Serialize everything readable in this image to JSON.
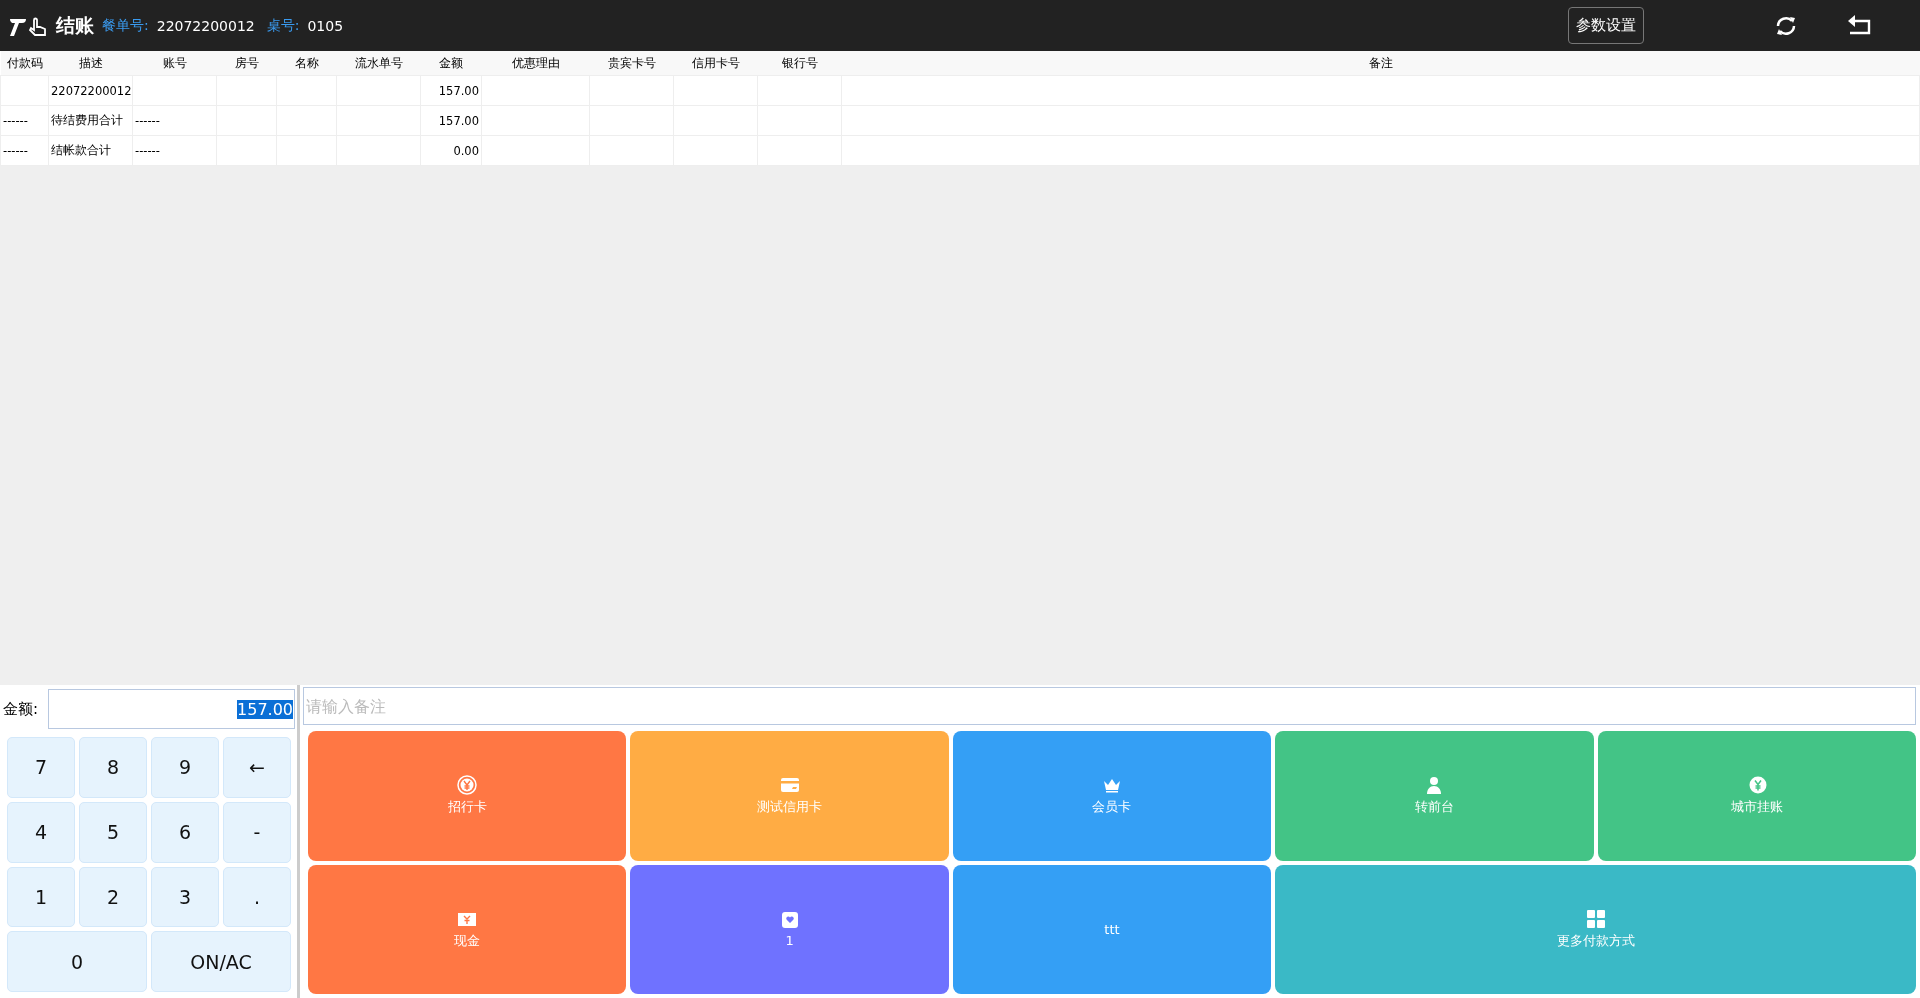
{
  "header": {
    "title": "结账",
    "order_label": "餐单号:",
    "order_no": "22072200012",
    "table_label": "桌号:",
    "table_no": "0105",
    "settings_button": "参数设置"
  },
  "table": {
    "columns": [
      "付款码",
      "描述",
      "账号",
      "房号",
      "名称",
      "流水单号",
      "金额",
      "优惠理由",
      "贵宾卡号",
      "信用卡号",
      "银行号",
      "备注"
    ],
    "rows": [
      {
        "description": "22072200012",
        "amount": "157.00"
      },
      {
        "payment_code": "------",
        "description": "待结费用合计",
        "account": "------",
        "amount": "157.00"
      },
      {
        "payment_code": "------",
        "description": "结帐款合计",
        "account": "------",
        "amount": "0.00"
      }
    ]
  },
  "amount_field": {
    "label": "金额:",
    "value": "157.00",
    "selected": true
  },
  "remark_field": {
    "placeholder": "请输入备注"
  },
  "keypad": [
    {
      "label": "7",
      "kind": "normal"
    },
    {
      "label": "8",
      "kind": "normal"
    },
    {
      "label": "9",
      "kind": "normal"
    },
    {
      "label": "←",
      "kind": "normal"
    },
    {
      "label": "4",
      "kind": "normal"
    },
    {
      "label": "5",
      "kind": "normal"
    },
    {
      "label": "6",
      "kind": "normal"
    },
    {
      "label": "-",
      "kind": "normal"
    },
    {
      "label": "1",
      "kind": "normal"
    },
    {
      "label": "2",
      "kind": "normal"
    },
    {
      "label": "3",
      "kind": "normal"
    },
    {
      "label": ".",
      "kind": "normal"
    },
    {
      "label": "0",
      "kind": "wide"
    },
    {
      "label": "ON/AC",
      "kind": "wide"
    }
  ],
  "payment_methods": [
    {
      "label": "招行卡",
      "color": "#ff7744"
    },
    {
      "label": "测试信用卡",
      "color": "#ffac44"
    },
    {
      "label": "会员卡",
      "color": "#349ff5"
    },
    {
      "label": "转前台",
      "color": "#43c486"
    },
    {
      "label": "城市挂账",
      "color": "#43c486"
    },
    {
      "label": "现金",
      "color": "#ff7744"
    },
    {
      "label": "1",
      "color": "#6f72ff"
    },
    {
      "label": "ttt",
      "color": "#349ff5"
    },
    {
      "label": "更多付款方式",
      "color": "#3ab9c6",
      "wide": true
    }
  ]
}
